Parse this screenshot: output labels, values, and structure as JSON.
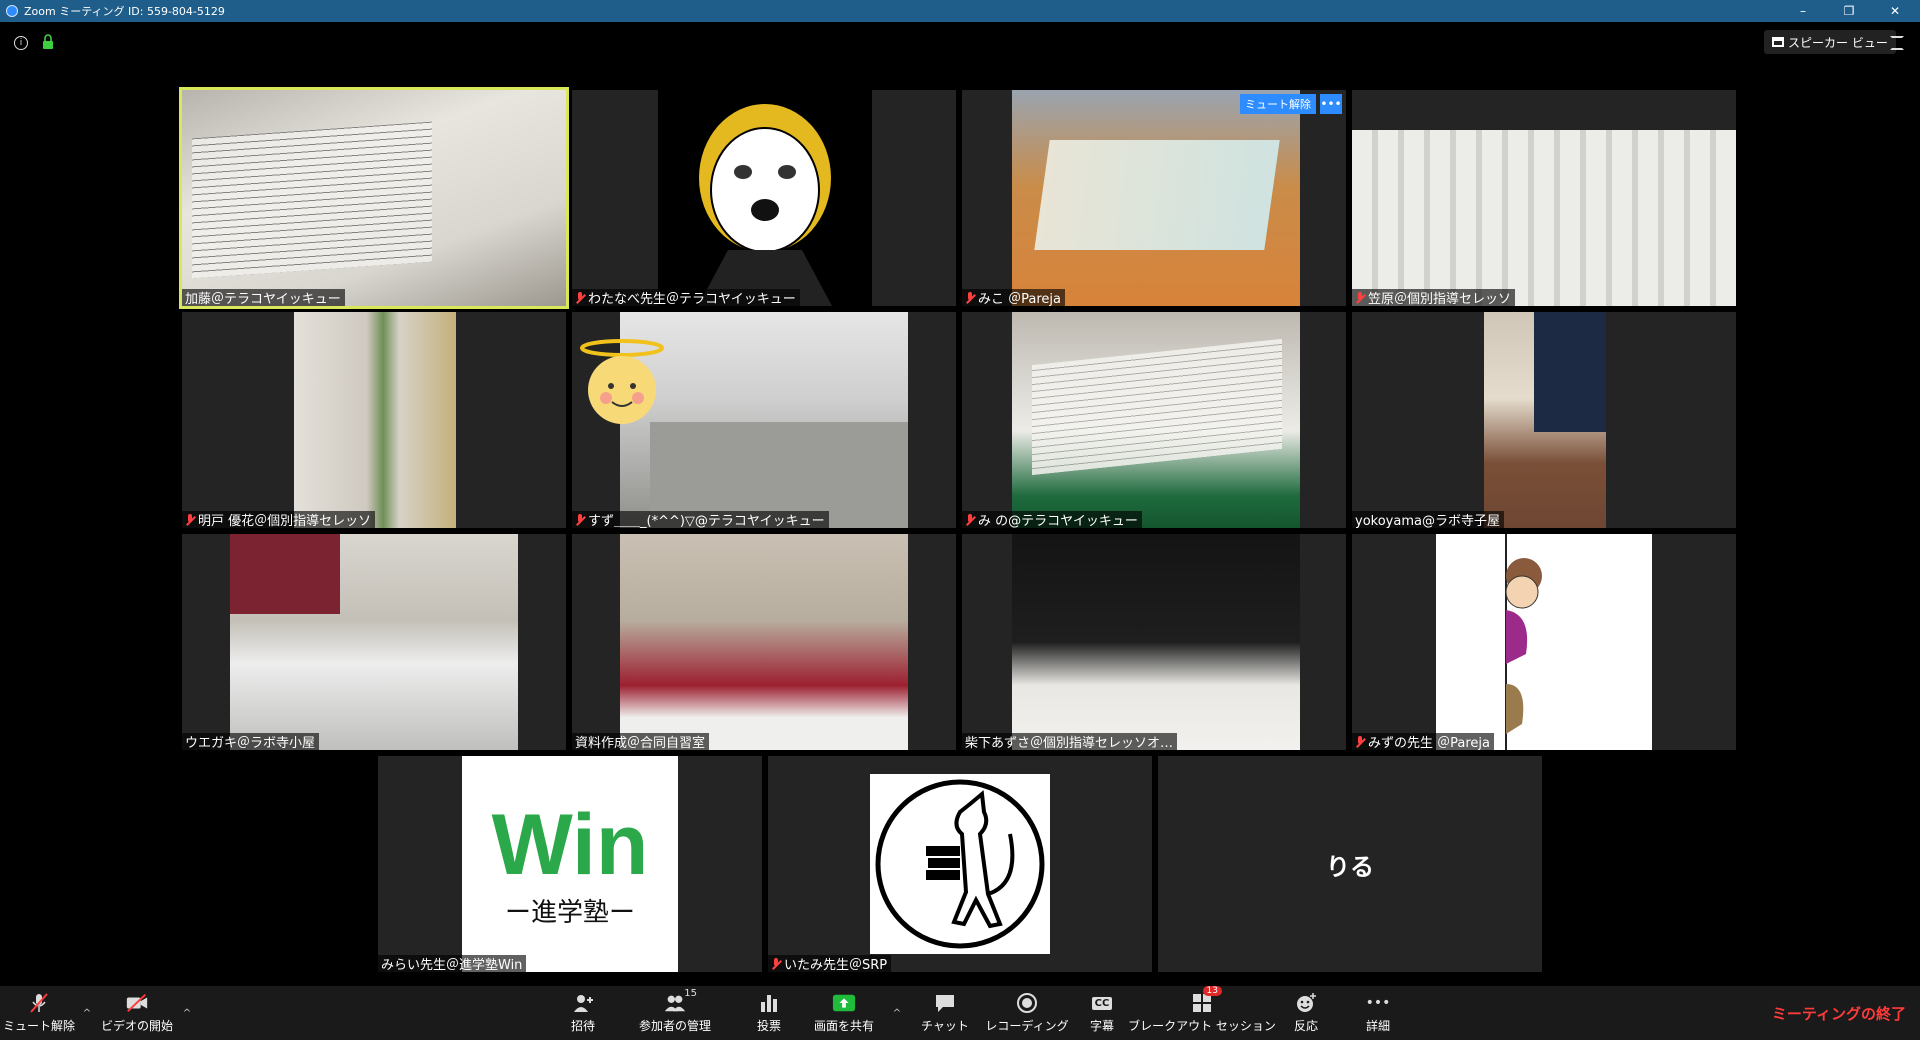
{
  "window": {
    "title": "Zoom ミーティング ID: 559-804-5129",
    "minimize": "–",
    "restore": "❐",
    "close": "✕"
  },
  "topbar": {
    "info": "i",
    "speaker_view": "スピーカー ビュー"
  },
  "tile_overlay": {
    "unmute": "ミュート解除",
    "more": "•••"
  },
  "participants": [
    {
      "name": "加藤＠テラコヤイッキュー",
      "muted": false,
      "active": true
    },
    {
      "name": "わたなべ先生＠テラコヤイッキュー",
      "muted": true
    },
    {
      "name": "みこ ＠Pareja",
      "muted": true
    },
    {
      "name": "笠原＠個別指導セレッソ",
      "muted": true
    },
    {
      "name": "明戸 優花＠個別指導セレッソ",
      "muted": true
    },
    {
      "name": "すず＿＿_(*^^)▽@テラコヤイッキュー",
      "muted": true
    },
    {
      "name": "み の@テラコヤイッキュー",
      "muted": true
    },
    {
      "name": "yokoyama@ラボ寺子屋",
      "muted": false
    },
    {
      "name": "ウエガキ＠ラボ寺小屋",
      "muted": false
    },
    {
      "name": "資料作成＠合同自習室",
      "muted": false
    },
    {
      "name": "柴下あずさ＠個別指導セレッソオ…",
      "muted": false
    },
    {
      "name": "みずの先生 ＠Pareja",
      "muted": true
    },
    {
      "name": "みらい先生＠進学塾Win",
      "muted": false
    },
    {
      "name": "いたみ先生＠SRP",
      "muted": true
    },
    {
      "name": "",
      "muted": false,
      "center_name": "りる"
    }
  ],
  "logos": {
    "win_main": "Win",
    "win_sub": "ー進学塾ー"
  },
  "toolbar": {
    "mute": "ミュート解除",
    "video": "ビデオの開始",
    "invite": "招待",
    "participants": "参加者の管理",
    "participants_count": "15",
    "polling": "投票",
    "share": "画面を共有",
    "chat": "チャット",
    "record": "レコーディング",
    "captions": "字幕",
    "captions_icon": "CC",
    "breakout": "ブレークアウト セッション",
    "breakout_count": "13",
    "reactions": "反応",
    "more": "詳細",
    "more_icon": "•••",
    "end": "ミーティングの終了",
    "caret": "^"
  },
  "colors": {
    "accent": "#2d8cff",
    "active_border": "#d8e85a",
    "end_red": "#ff3b3b",
    "muted_red": "#ff4040",
    "tile_bg": "#242424"
  }
}
